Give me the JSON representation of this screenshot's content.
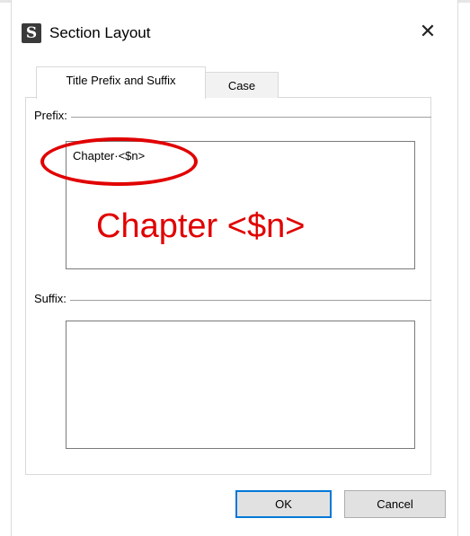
{
  "window": {
    "title": "Section Layout",
    "app_icon_glyph": "S",
    "close_glyph": "✕"
  },
  "tabs": [
    {
      "label": "Title Prefix and Suffix",
      "active": true
    },
    {
      "label": "Case",
      "active": false
    }
  ],
  "prefix": {
    "label": "Prefix:",
    "value": "Chapter·<$n>"
  },
  "suffix": {
    "label": "Suffix:",
    "value": ""
  },
  "annotation": {
    "text": "Chapter <$n>",
    "color": "#e10000"
  },
  "buttons": {
    "ok_label": "OK",
    "cancel_label": "Cancel"
  },
  "colors": {
    "accent": "#0078d7",
    "annotation": "#e10000"
  }
}
